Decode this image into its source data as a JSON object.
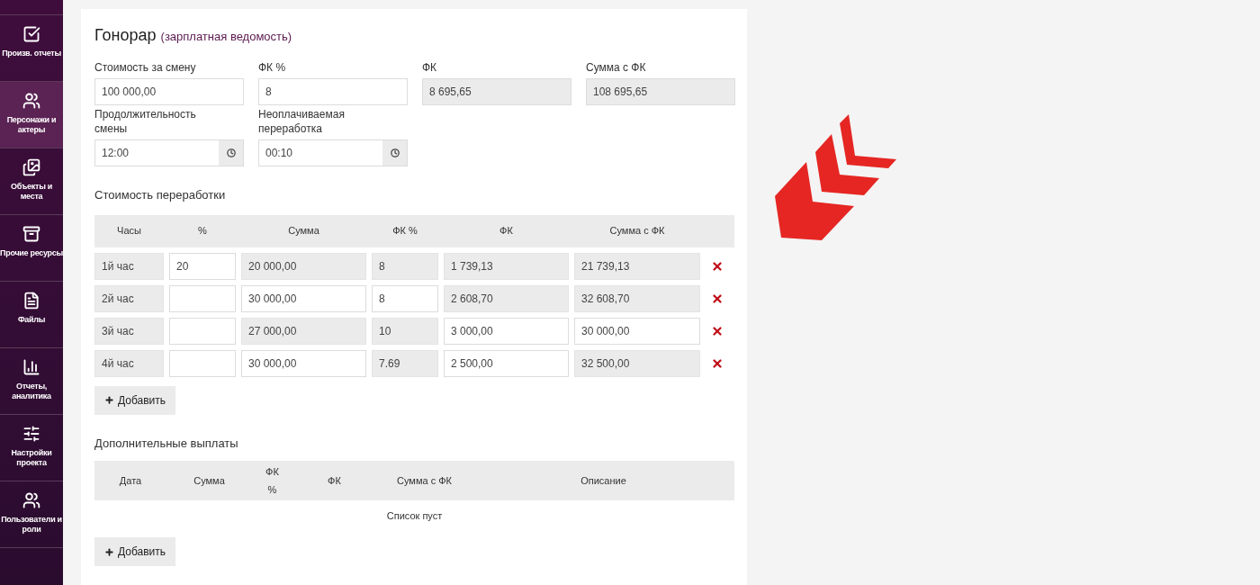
{
  "sidebar": {
    "items": [
      {
        "label": "Произв. отчеты",
        "selected": false
      },
      {
        "label": "Персонажи и актеры",
        "selected": true
      },
      {
        "label": "Объекты и места",
        "selected": false
      },
      {
        "label": "Прочие ресурсы",
        "selected": false
      },
      {
        "label": "Файлы",
        "selected": false
      },
      {
        "label": "Отчеты, аналитика",
        "selected": false
      },
      {
        "label": "Настройки проекта",
        "selected": false
      },
      {
        "label": "Пользователи и роли",
        "selected": false
      }
    ]
  },
  "title": {
    "main": "Гонорар",
    "sub": "(зарплатная ведомость)"
  },
  "fields": [
    {
      "kind": "text",
      "label": "Стоимость за смену",
      "value": "100 000,00",
      "editable": true
    },
    {
      "kind": "text",
      "label": "ФК %",
      "value": "8",
      "editable": true
    },
    {
      "kind": "text",
      "label": "ФК",
      "value": "8 695,65",
      "editable": false
    },
    {
      "kind": "text",
      "label": "Сумма с ФК",
      "value": "108 695,65",
      "editable": false
    },
    {
      "kind": "time",
      "label": "Продолжительность смены",
      "value": "12:00",
      "editable": true
    },
    {
      "kind": "time",
      "label": "Неоплачиваемая переработка",
      "value": "00:10",
      "editable": true
    }
  ],
  "overtime": {
    "title": "Стоимость переработки",
    "columns": [
      "Часы",
      "%",
      "Сумма",
      "ФК %",
      "ФК",
      "Сумма с ФК"
    ],
    "rows": [
      {
        "cells": [
          {
            "value": "1й час",
            "editable": false
          },
          {
            "value": "20",
            "editable": true
          },
          {
            "value": "20 000,00",
            "editable": false
          },
          {
            "value": "8",
            "editable": false
          },
          {
            "value": "1 739,13",
            "editable": false
          },
          {
            "value": "21 739,13",
            "editable": false
          }
        ]
      },
      {
        "cells": [
          {
            "value": "2й час",
            "editable": false
          },
          {
            "editable": true
          },
          {
            "value": "30 000,00",
            "editable": true
          },
          {
            "value": "8",
            "editable": true
          },
          {
            "value": "2 608,70",
            "editable": false
          },
          {
            "value": "32 608,70",
            "editable": false
          }
        ]
      },
      {
        "cells": [
          {
            "value": "3й час",
            "editable": false
          },
          {
            "editable": true
          },
          {
            "value": "27 000,00",
            "editable": false
          },
          {
            "value": "10",
            "editable": false
          },
          {
            "value": "3 000,00",
            "editable": true
          },
          {
            "value": "30 000,00",
            "editable": true
          }
        ]
      },
      {
        "cells": [
          {
            "value": "4й час",
            "editable": false
          },
          {
            "editable": true
          },
          {
            "value": "30 000,00",
            "editable": true
          },
          {
            "value": "7.69",
            "editable": false
          },
          {
            "value": "2 500,00",
            "editable": true
          },
          {
            "value": "32 500,00",
            "editable": false
          }
        ]
      }
    ],
    "add_button": "Добавить"
  },
  "extra": {
    "title": "Дополнительные выплаты",
    "columns": [
      "Дата",
      "Сумма",
      "ФК %",
      "ФК",
      "Сумма с ФК",
      "Описание"
    ],
    "empty_text": "Список пуст",
    "add_button": "Добавить"
  }
}
